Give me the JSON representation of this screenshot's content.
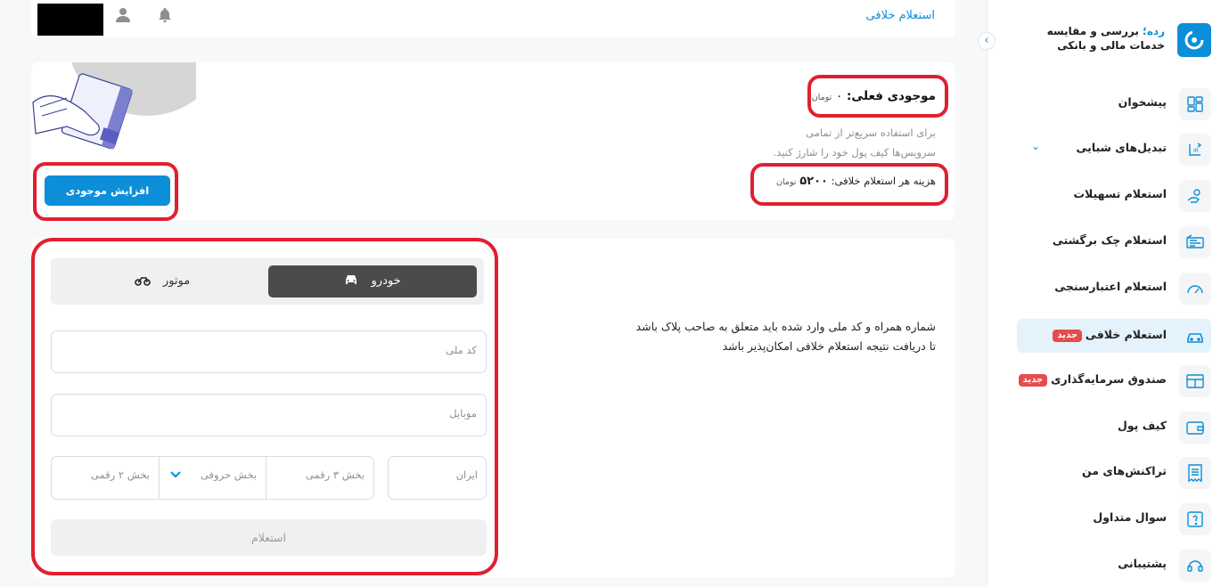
{
  "brand": {
    "accent_word": "رده؛",
    "line1": " بررسی و مقایسه",
    "line2": "خدمات مالی و بانکی"
  },
  "sidebar": {
    "collapse_glyph": "‹",
    "items": [
      {
        "label": "پیشخوان",
        "icon": "dashboard-icon",
        "badge": ""
      },
      {
        "label": "تبدیل‌های شبایی",
        "icon": "iban-convert-icon",
        "badge": "",
        "expandable": true
      },
      {
        "label": "استعلام تسهیلات",
        "icon": "loan-hand-icon",
        "badge": ""
      },
      {
        "label": "استعلام چک برگشتی",
        "icon": "cheque-icon",
        "badge": ""
      },
      {
        "label": "استعلام اعتبارسنجی",
        "icon": "gauge-icon",
        "badge": ""
      },
      {
        "label": "استعلام خلافی",
        "icon": "car-icon",
        "badge": "جدید",
        "active": true
      },
      {
        "label": "صندوق سرمایه‌گذاری",
        "icon": "fund-icon",
        "badge": "جدید"
      },
      {
        "label": "کیف پول",
        "icon": "wallet-icon",
        "badge": ""
      },
      {
        "label": "تراکنش‌های من",
        "icon": "receipt-icon",
        "badge": ""
      },
      {
        "label": "سوال متداول",
        "icon": "question-icon",
        "badge": ""
      },
      {
        "label": "پشتیبانی",
        "icon": "headset-icon",
        "badge": ""
      }
    ]
  },
  "topbar": {
    "title": "استعلام خلافی",
    "icons": [
      "user-icon",
      "bell-icon"
    ]
  },
  "balance": {
    "label": "موجودی فعلی:",
    "amount": "۰",
    "unit": "تومان",
    "desc_line1": "برای استفاده سریع‌تر از تمامی",
    "desc_line2": "سرویس‌ها کیف پول خود را شارژ کنید.",
    "fee_label": "هزینه هر استعلام خلافی:",
    "fee_amount": "۵۲۰۰",
    "fee_unit": "تومان",
    "increase_button": "افزایش موجودی"
  },
  "inquiry": {
    "info_line1": "شماره همراه و کد ملی وارد شده باید متعلق به صاحب پلاک باشد",
    "info_line2": "تا دریافت نتیجه استعلام خلافی امکان‌پذیر باشد",
    "tabs": {
      "car": "خودرو",
      "motor": "موتور"
    },
    "national_code_placeholder": "کد ملی",
    "mobile_placeholder": "موبایل",
    "plate": {
      "iran": "ایران",
      "three_digit": "بخش ۳ رقمی",
      "letter": "بخش حروفی",
      "two_digit": "بخش ۲ رقمی"
    },
    "submit": "استعلام"
  },
  "colors": {
    "accent": "#0c8fd8",
    "badge": "#e64c4c",
    "highlight": "#e02030"
  }
}
